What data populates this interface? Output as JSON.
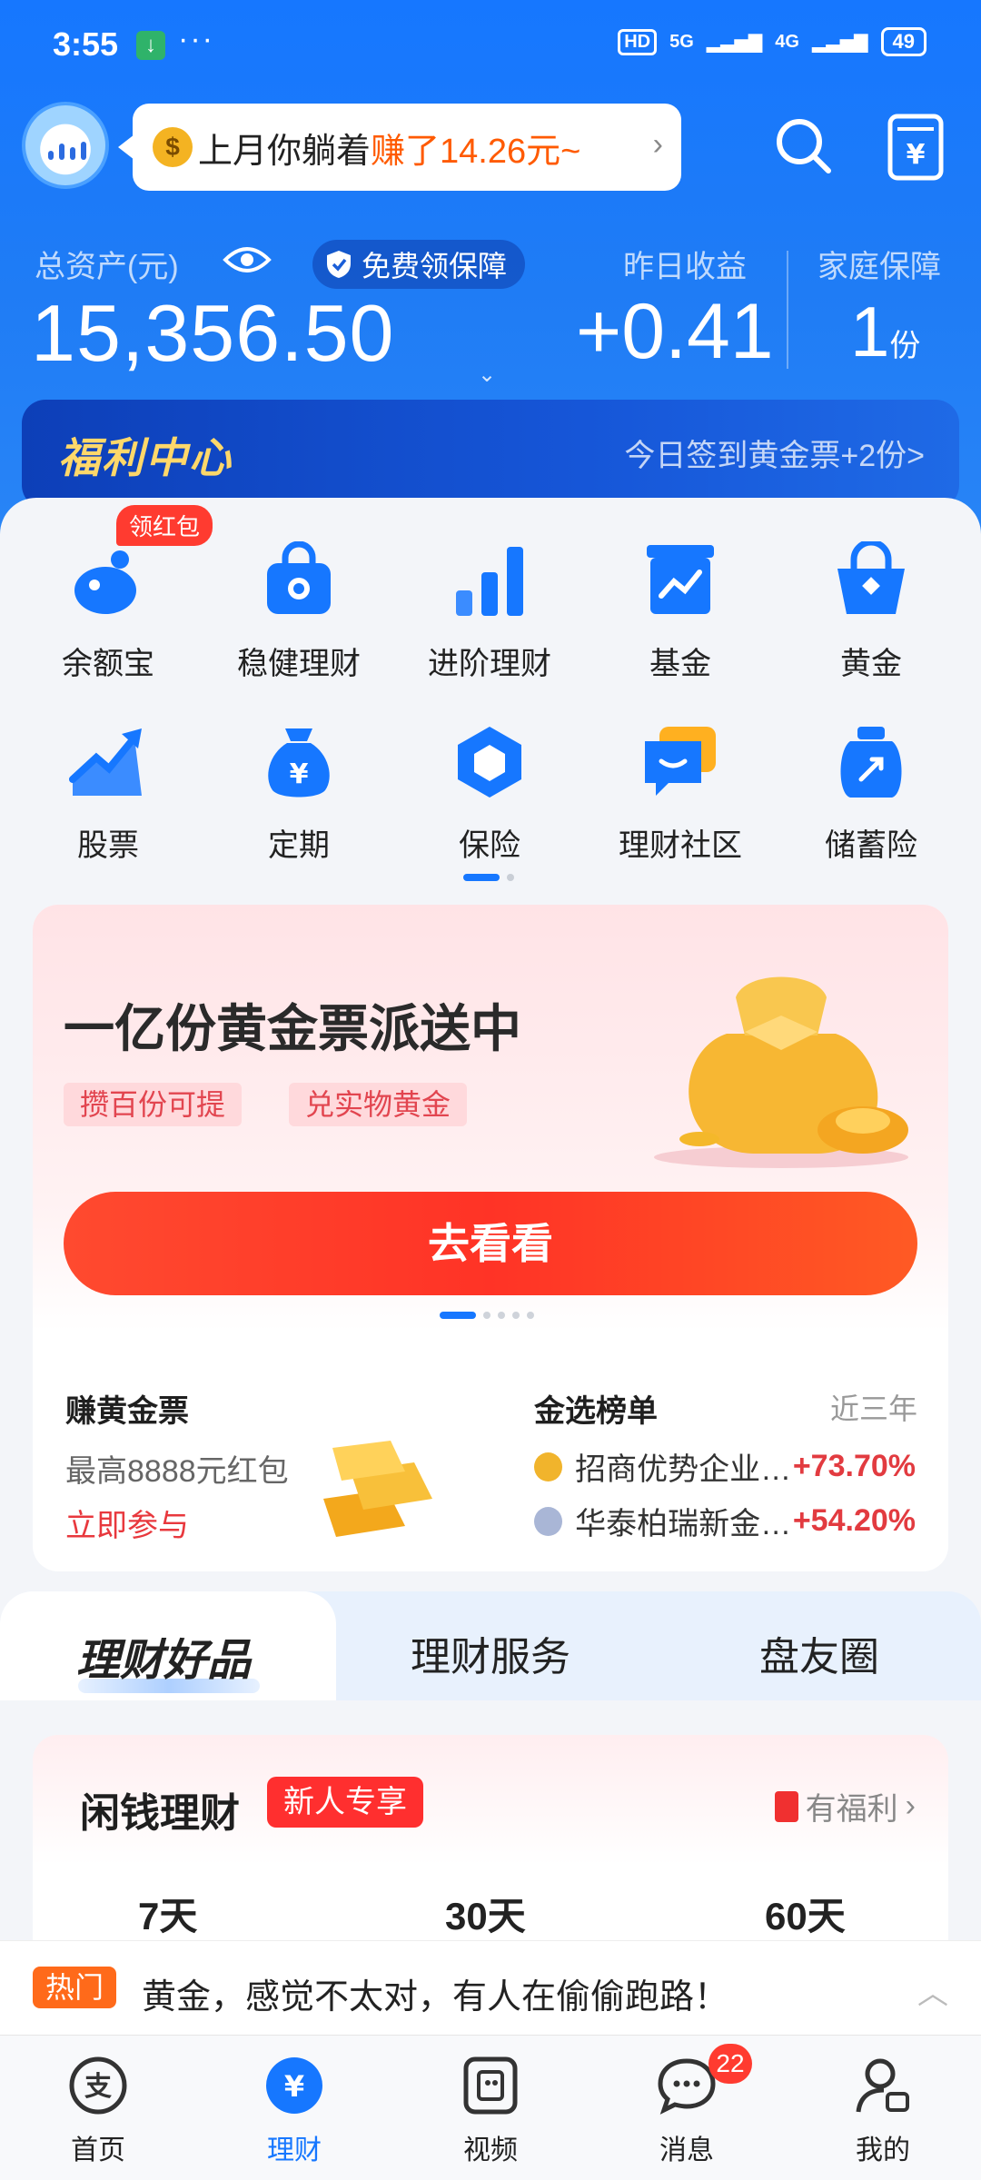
{
  "status_bar": {
    "time": "3:55",
    "network_a": "5G",
    "network_b": "4G",
    "hd": "HD",
    "battery": "49"
  },
  "header": {
    "bubble_prefix": "上月你躺着",
    "bubble_highlight": "赚了14.26元~",
    "assets_label": "总资产(元)",
    "protect_label": "免费领保障",
    "assets_value": "15,356.50",
    "yesterday_label": "昨日收益",
    "yesterday_value": "+0.41",
    "family_label": "家庭保障",
    "family_value": "1",
    "family_unit": "份"
  },
  "welfare": {
    "title": "福利中心",
    "right": "今日签到黄金票+2份>"
  },
  "grid": {
    "badge": "领红包",
    "items": [
      {
        "label": "余额宝",
        "icon": "yuebao-icon"
      },
      {
        "label": "稳健理财",
        "icon": "lock-bag-icon"
      },
      {
        "label": "进阶理财",
        "icon": "bars-up-icon"
      },
      {
        "label": "基金",
        "icon": "fund-chart-icon"
      },
      {
        "label": "黄金",
        "icon": "gold-basket-icon"
      },
      {
        "label": "股票",
        "icon": "stock-trend-icon"
      },
      {
        "label": "定期",
        "icon": "money-bag-icon"
      },
      {
        "label": "保险",
        "icon": "shield-hexagon-icon"
      },
      {
        "label": "理财社区",
        "icon": "chat-community-icon"
      },
      {
        "label": "储蓄险",
        "icon": "savings-jar-icon"
      }
    ]
  },
  "banner": {
    "headline": "一亿份黄金票派送中",
    "chip1": "攒百份可提",
    "chip2": "兑实物黄金",
    "cta": "去看看"
  },
  "earn": {
    "title": "赚黄金票",
    "subtitle": "最高8888元红包",
    "action": "立即参与"
  },
  "ranking": {
    "title": "金选榜单",
    "range": "近三年",
    "rows": [
      {
        "name": "招商优势企业…",
        "pct": "+73.70%"
      },
      {
        "name": "华泰柏瑞新金…",
        "pct": "+54.20%"
      }
    ]
  },
  "tabs": [
    "理财好品",
    "理财服务",
    "盘友圈"
  ],
  "money_card": {
    "title": "闲钱理财",
    "badge": "新人专享",
    "fuli": "有福利",
    "periods": [
      "7天",
      "30天",
      "60天"
    ]
  },
  "notice": {
    "tag": "热门",
    "text": "黄金，感觉不太对，有人在偷偷跑路！"
  },
  "bottom_nav": {
    "items": [
      "首页",
      "理财",
      "视频",
      "消息",
      "我的"
    ],
    "message_badge": "22"
  },
  "colors": {
    "brand_blue": "#1677ff",
    "accent_red": "#ff3b30",
    "gold": "#ffd86a"
  }
}
